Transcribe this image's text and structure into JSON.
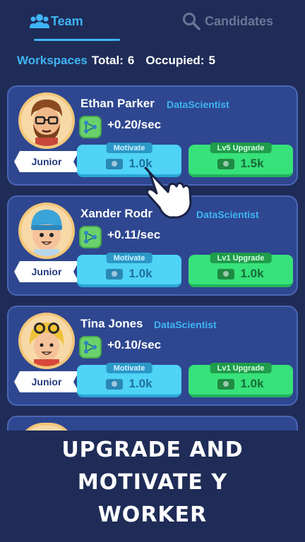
{
  "tabs": {
    "team": "Team",
    "candidates": "Candidates"
  },
  "stats": {
    "workspaces_label": "Workspaces",
    "total_label": "Total:",
    "total_value": "6",
    "occupied_label": "Occupied:",
    "occupied_value": "5"
  },
  "workers": [
    {
      "name": "Ethan Parker",
      "role": "DataScientist",
      "rate": "+0.20/sec",
      "level": "Junior",
      "motivate_label": "Motivate",
      "motivate_cost": "1.0k",
      "upgrade_label": "Lv5 Upgrade",
      "upgrade_cost": "1.5k"
    },
    {
      "name": "Xander Rodr",
      "role": "DataScientist",
      "rate": "+0.11/sec",
      "level": "Junior",
      "motivate_label": "Motivate",
      "motivate_cost": "1.0k",
      "upgrade_label": "Lv1 Upgrade",
      "upgrade_cost": "1.0k"
    },
    {
      "name": "Tina Jones",
      "role": "DataScientist",
      "rate": "+0.10/sec",
      "level": "Junior",
      "motivate_label": "Motivate",
      "motivate_cost": "1.0k",
      "upgrade_label": "Lv1 Upgrade",
      "upgrade_cost": "1.0k"
    }
  ],
  "banner": {
    "line1": "UPGRADE AND",
    "line2": "MOTIVATE Y",
    "line3": "WORKER"
  },
  "colors": {
    "background": "#1f2c57",
    "card": "#2e4790",
    "accent": "#3fb5f5",
    "motivate": "#4fd3f7",
    "upgrade": "#37e27a"
  },
  "icons": {
    "team_tab": "team-icon",
    "candidates_tab": "search-icon",
    "rate": "network-icon",
    "cost": "cash-icon",
    "pointer": "hand-pointer-icon"
  }
}
